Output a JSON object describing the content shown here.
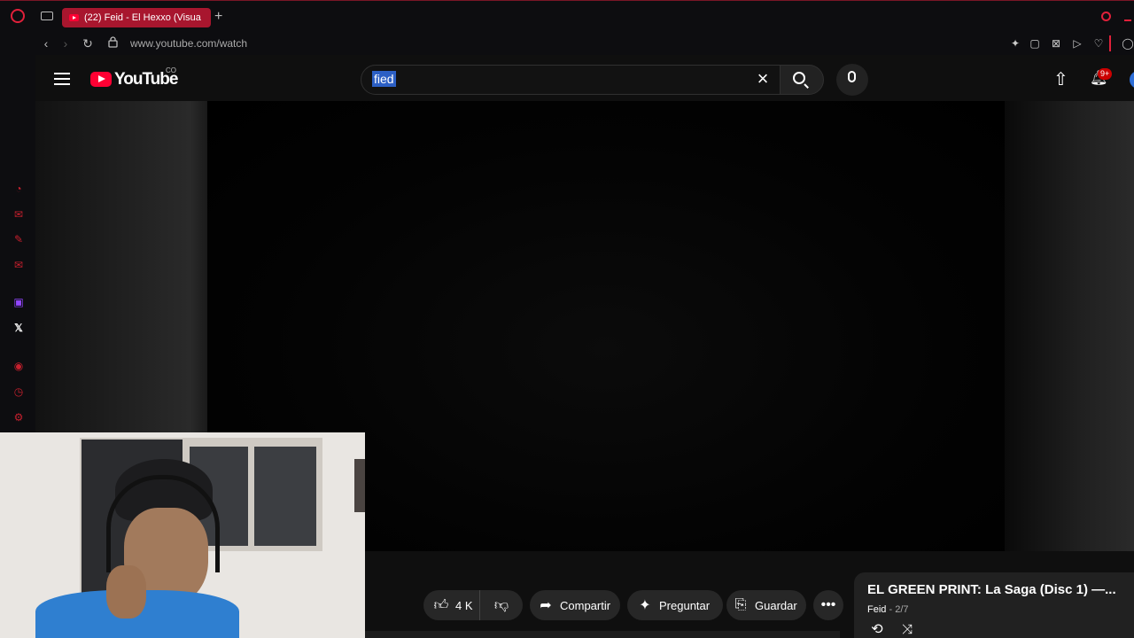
{
  "browser": {
    "tab_title": "(22) Feid - El Hexxo (Visua",
    "new_tab_symbol": "+",
    "url": "www.youtube.com/watch"
  },
  "youtube": {
    "logo_text": "YouTube",
    "country_code": "CO",
    "search_query": "fied",
    "notification_count": "9+"
  },
  "actions": {
    "like_count": "4 K",
    "share_label": "Compartir",
    "ask_label": "Preguntar",
    "save_label": "Guardar"
  },
  "playlist": {
    "title": "EL GREEN PRINT: La Saga (Disc 1) —...",
    "owner": "Feid",
    "position": "2/7"
  },
  "icons": {
    "sidebar": [
      "refresh-circle-icon",
      "chat-icon",
      "pen-icon",
      "email-icon",
      "twitch-icon",
      "x-icon",
      "player-icon",
      "history-icon",
      "settings-icon"
    ]
  },
  "colors": {
    "browser_accent": "#e0203a",
    "active_tab": "#a8162e",
    "yt_red": "#ff0033",
    "page_bg": "#0f0f0f",
    "pill_bg": "#272727"
  }
}
